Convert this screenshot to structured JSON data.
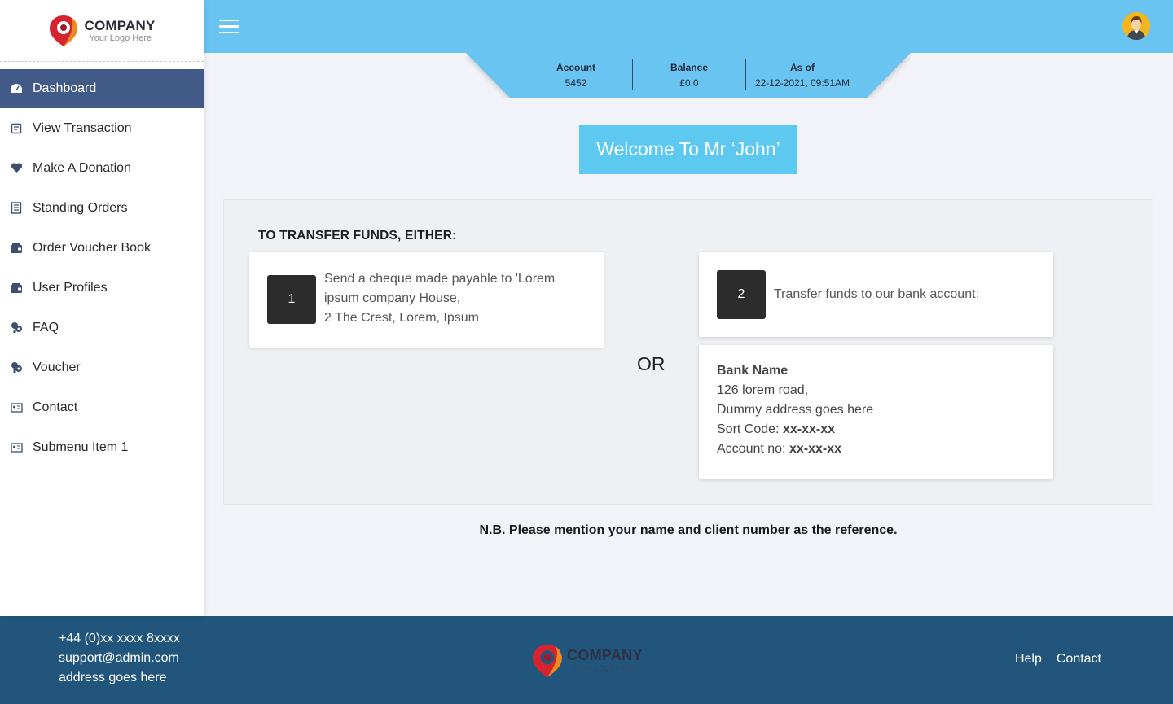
{
  "brand": {
    "name": "COMPANY",
    "tagline": "Your Logo Here",
    "colors": {
      "red": "#d5242f",
      "orange": "#f08a1f"
    }
  },
  "sidebar": {
    "items": [
      {
        "label": "Dashboard",
        "icon": "dashboard-icon",
        "active": true
      },
      {
        "label": "View Transaction",
        "icon": "transaction-icon"
      },
      {
        "label": "Make A Donation",
        "icon": "heart-icon"
      },
      {
        "label": "Standing Orders",
        "icon": "document-icon"
      },
      {
        "label": "Order Voucher Book",
        "icon": "wallet-icon"
      },
      {
        "label": "User Profiles",
        "icon": "wallet-icon"
      },
      {
        "label": "FAQ",
        "icon": "faq-icon"
      },
      {
        "label": "Voucher",
        "icon": "voucher-icon"
      },
      {
        "label": "Contact",
        "icon": "contact-card-icon"
      },
      {
        "label": "Submenu Item 1",
        "icon": "contact-card-icon"
      }
    ]
  },
  "header": {
    "menu_icon": "hamburger-icon",
    "avatar_icon": "user-avatar-icon",
    "color": "#69c4f1"
  },
  "account": {
    "account_label": "Account",
    "account_value": "5452",
    "balance_label": "Balance",
    "balance_value": "£0.0",
    "asof_label": "As of",
    "asof_value": "22-12-2021, 09:51AM"
  },
  "welcome": "Welcome To Mr ‘John’",
  "transfer": {
    "title": "TO TRANSFER FUNDS, EITHER:",
    "option1": {
      "number": "1",
      "line1": "Send a cheque made payable to 'Lorem",
      "line2": "ipsum company House,",
      "line3": "2 The Crest, Lorem, Ipsum"
    },
    "or": "OR",
    "option2": {
      "number": "2",
      "text": "Transfer funds to our bank account:"
    },
    "bank": {
      "name": "Bank Name",
      "address1": "126 lorem road,",
      "address2": "Dummy address goes here",
      "sort_label": "Sort Code:",
      "sort_value": "xx-xx-xx",
      "account_label": "Account no:",
      "account_value": "xx-xx-xx"
    }
  },
  "note": "N.B. Please mention your name and client number as the reference.",
  "footer": {
    "phone": "+44 (0)xx xxxx 8xxxx",
    "email": "support@admin.com",
    "address": "address goes here",
    "links": {
      "help": "Help",
      "contact": "Contact"
    },
    "color": "#21557c"
  }
}
